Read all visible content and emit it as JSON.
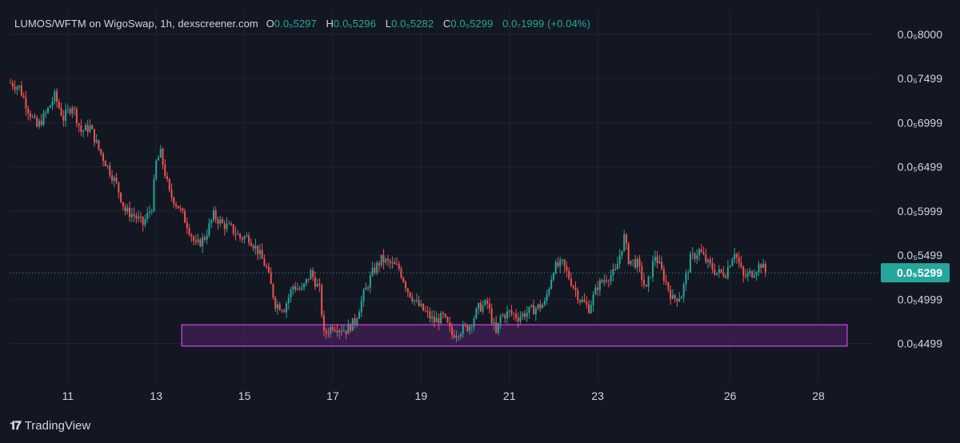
{
  "header": {
    "title": "LUMOS/WFTM on WigoSwap, 1h, dexscreener.com",
    "open_label": "O",
    "open_value": "0.0₅5297",
    "high_label": "H",
    "high_value": "0.0₅5296",
    "low_label": "L",
    "low_value": "0.0₅5282",
    "close_label": "C",
    "close_value": "0.0₅5299",
    "change": "0.0₇1999 (+0.04%)"
  },
  "last_price_label": "0.0₅5299",
  "footer": {
    "brand": "TradingView",
    "logo_icon": "tradingview-logo-icon"
  },
  "colors": {
    "background": "#131722",
    "grid": "#1f2433",
    "up": "#26a69a",
    "down": "#ef5350",
    "zone_fill": "#3d1d4f",
    "zone_border": "#b040c8",
    "price_badge": "#26a69a",
    "text": "#d1d4dc"
  },
  "chart_data": {
    "type": "candlestick",
    "title": "LUMOS/WFTM on WigoSwap, 1h, dexscreener.com",
    "y_unit": "×1e-6 WFTM",
    "yticks": [
      {
        "value": 7.999,
        "label": "0.0₅8000"
      },
      {
        "value": 7.499,
        "label": "0.0₅7499"
      },
      {
        "value": 6.999,
        "label": "0.0₅6999"
      },
      {
        "value": 6.499,
        "label": "0.0₅6499"
      },
      {
        "value": 5.999,
        "label": "0.0₅5999"
      },
      {
        "value": 5.499,
        "label": "0.0₅5499"
      },
      {
        "value": 4.999,
        "label": "0.0₅4999"
      },
      {
        "value": 4.499,
        "label": "0.0₅4499"
      }
    ],
    "ylim": [
      4.06,
      8.28
    ],
    "xticks": [
      {
        "day": 11,
        "label": "11"
      },
      {
        "day": 13,
        "label": "13"
      },
      {
        "day": 15,
        "label": "15"
      },
      {
        "day": 17,
        "label": "17"
      },
      {
        "day": 19,
        "label": "19"
      },
      {
        "day": 21,
        "label": "21"
      },
      {
        "day": 23,
        "label": "23"
      },
      {
        "day": 26,
        "label": "26"
      },
      {
        "day": 28,
        "label": "28"
      }
    ],
    "xlim": [
      9.68,
      29.25
    ],
    "last_price": 5.299,
    "support_zone": {
      "from_day": 13.58,
      "to_day": 28.65,
      "low": 4.47,
      "high": 4.71
    },
    "series": [
      {
        "name": "close",
        "points": [
          [
            9.7,
            7.45
          ],
          [
            9.9,
            7.4
          ],
          [
            10.1,
            7.15
          ],
          [
            10.3,
            6.95
          ],
          [
            10.5,
            7.1
          ],
          [
            10.7,
            7.3
          ],
          [
            10.9,
            7.05
          ],
          [
            11.1,
            7.2
          ],
          [
            11.3,
            6.9
          ],
          [
            11.5,
            6.95
          ],
          [
            11.7,
            6.7
          ],
          [
            11.9,
            6.5
          ],
          [
            12.1,
            6.3
          ],
          [
            12.3,
            6.0
          ],
          [
            12.5,
            5.95
          ],
          [
            12.7,
            5.85
          ],
          [
            12.9,
            6.05
          ],
          [
            13.0,
            6.55
          ],
          [
            13.1,
            6.65
          ],
          [
            13.3,
            6.2
          ],
          [
            13.5,
            6.05
          ],
          [
            13.7,
            5.85
          ],
          [
            13.9,
            5.6
          ],
          [
            14.1,
            5.7
          ],
          [
            14.3,
            5.95
          ],
          [
            14.5,
            5.85
          ],
          [
            14.7,
            5.8
          ],
          [
            14.9,
            5.7
          ],
          [
            15.1,
            5.7
          ],
          [
            15.3,
            5.55
          ],
          [
            15.5,
            5.35
          ],
          [
            15.7,
            4.95
          ],
          [
            15.9,
            4.9
          ],
          [
            16.1,
            5.15
          ],
          [
            16.3,
            5.1
          ],
          [
            16.5,
            5.3
          ],
          [
            16.7,
            5.1
          ],
          [
            16.8,
            4.6
          ],
          [
            17.0,
            4.7
          ],
          [
            17.3,
            4.65
          ],
          [
            17.5,
            4.75
          ],
          [
            17.7,
            5.05
          ],
          [
            17.9,
            5.3
          ],
          [
            18.1,
            5.45
          ],
          [
            18.3,
            5.4
          ],
          [
            18.5,
            5.35
          ],
          [
            18.7,
            5.1
          ],
          [
            18.9,
            4.95
          ],
          [
            19.1,
            4.85
          ],
          [
            19.3,
            4.75
          ],
          [
            19.5,
            4.8
          ],
          [
            19.7,
            4.6
          ],
          [
            19.9,
            4.65
          ],
          [
            20.1,
            4.7
          ],
          [
            20.3,
            4.9
          ],
          [
            20.5,
            4.95
          ],
          [
            20.7,
            4.6
          ],
          [
            20.8,
            4.8
          ],
          [
            21.0,
            4.85
          ],
          [
            21.2,
            4.8
          ],
          [
            21.4,
            4.85
          ],
          [
            21.6,
            4.9
          ],
          [
            21.8,
            4.95
          ],
          [
            22.0,
            5.35
          ],
          [
            22.2,
            5.4
          ],
          [
            22.4,
            5.2
          ],
          [
            22.6,
            5.0
          ],
          [
            22.8,
            4.9
          ],
          [
            23.0,
            5.15
          ],
          [
            23.2,
            5.25
          ],
          [
            23.4,
            5.3
          ],
          [
            23.6,
            5.7
          ],
          [
            23.7,
            5.45
          ],
          [
            23.9,
            5.4
          ],
          [
            24.1,
            5.1
          ],
          [
            24.3,
            5.5
          ],
          [
            24.5,
            5.25
          ],
          [
            24.7,
            5.0
          ],
          [
            24.9,
            5.05
          ],
          [
            25.1,
            5.45
          ],
          [
            25.3,
            5.55
          ],
          [
            25.5,
            5.4
          ],
          [
            25.7,
            5.3
          ],
          [
            25.9,
            5.3
          ],
          [
            26.1,
            5.55
          ],
          [
            26.3,
            5.25
          ],
          [
            26.5,
            5.3
          ],
          [
            26.7,
            5.4
          ],
          [
            26.8,
            5.3
          ]
        ]
      }
    ]
  }
}
